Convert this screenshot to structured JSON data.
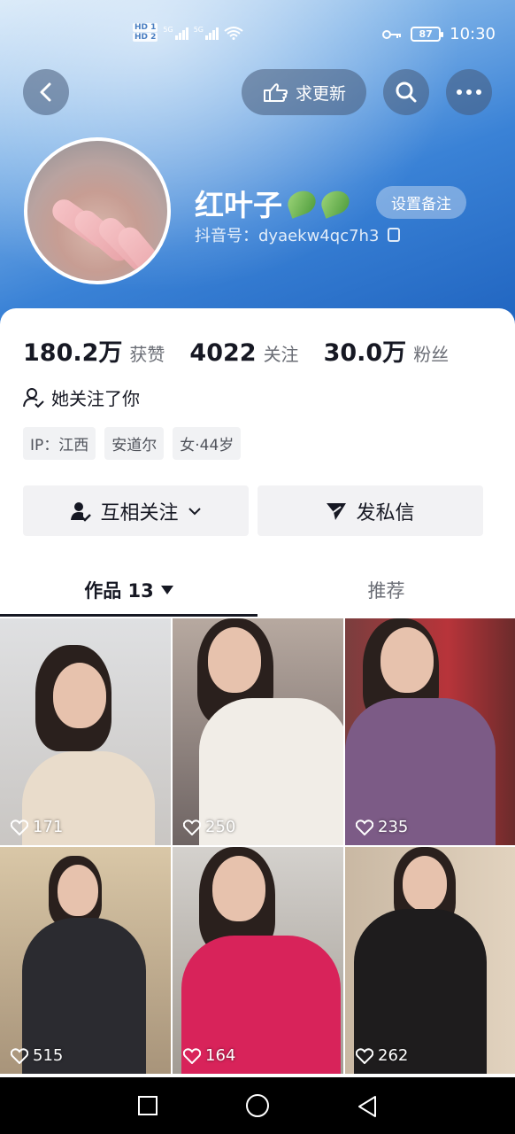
{
  "status_bar": {
    "hd1": "HD 1",
    "hd2": "HD 2",
    "net1": "5G",
    "net2": "5G",
    "battery": "87",
    "time": "10:30"
  },
  "top_nav": {
    "request_update_label": "求更新"
  },
  "profile": {
    "nickname": "红叶子",
    "set_remark_label": "设置备注",
    "douyin_id": "抖音号：dyaekw4qc7h3"
  },
  "stats": [
    {
      "value": "180.2万",
      "label": "获赞"
    },
    {
      "value": "4022",
      "label": "关注"
    },
    {
      "value": "30.0万",
      "label": "粉丝"
    }
  ],
  "follows_you_text": "她关注了你",
  "tags": [
    "IP：江西",
    "安道尔",
    "女·44岁"
  ],
  "actions": {
    "mutual_follow_label": "互相关注",
    "message_label": "发私信"
  },
  "tabs": {
    "works_label": "作品 13",
    "recommend_label": "推荐"
  },
  "videos": [
    {
      "likes": "171"
    },
    {
      "likes": "250"
    },
    {
      "likes": "235"
    },
    {
      "likes": "515"
    },
    {
      "likes": "164"
    },
    {
      "likes": "262"
    }
  ],
  "colors": {
    "header_gradient_end": "#1f63bf",
    "button_bg": "#f2f2f4",
    "text_primary": "#161823",
    "text_secondary": "#6b6e76"
  }
}
